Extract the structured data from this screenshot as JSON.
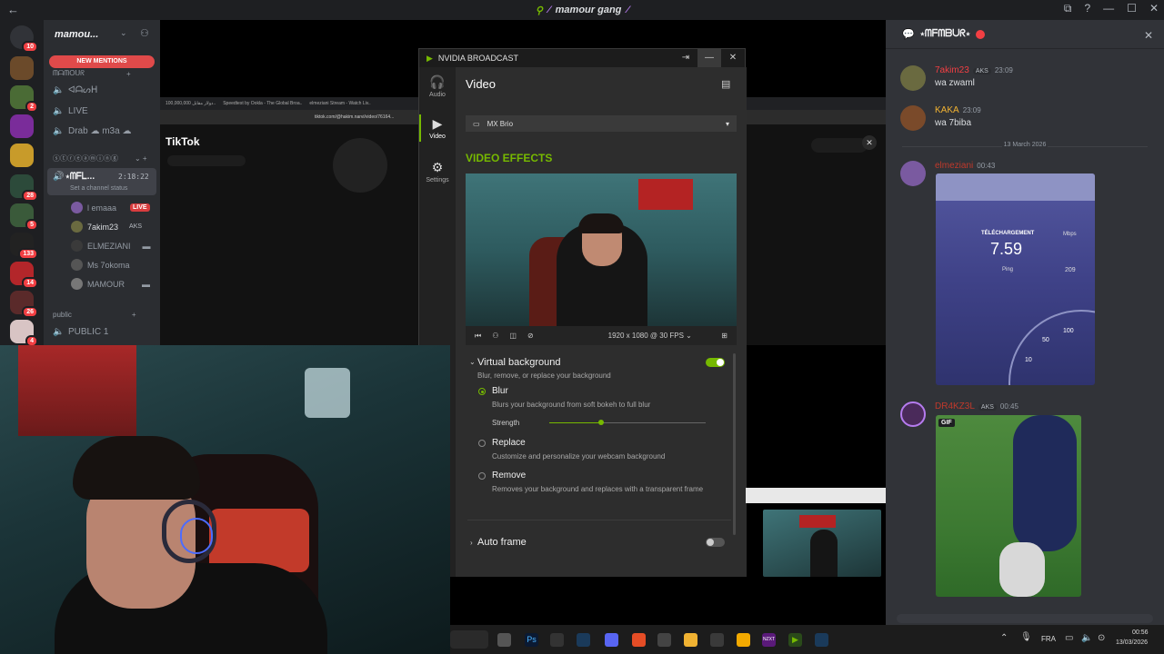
{
  "window": {
    "title": "mamour gang"
  },
  "sidebar": {
    "server_name": "mamou...",
    "new_mentions": "NEW MENTIONS",
    "category_one": "ᗰᗩᗰOᑌᖇ",
    "channels": [
      {
        "label": "ᐊᗩᔕᕼ",
        "icon": "speaker-icon"
      },
      {
        "label": "LIVE",
        "icon": "speaker-icon"
      },
      {
        "label": "Drab ☁ m3a ☁",
        "icon": "speaker-icon"
      }
    ],
    "category_two": "ⓢⓣⓡⓔⓐⓜⓘⓝⓖ",
    "active_channel": {
      "label": "⋆ᗰᖴᒪ...",
      "timer": "2:18:22",
      "status": "Set a channel status"
    },
    "voice_users": [
      {
        "name": "l emaaa",
        "live": "LIVE"
      },
      {
        "name": "7akim23",
        "tag": "AKS"
      },
      {
        "name": "ELMEZIANI"
      },
      {
        "name": "Ms 7okoma"
      },
      {
        "name": "MAMOUR"
      }
    ],
    "category_three": "public",
    "public_channel": "PUBLIC 1",
    "server_badges": [
      "10",
      "",
      "2",
      "",
      "",
      "28",
      "5",
      "133",
      "14",
      "26",
      "4"
    ]
  },
  "browser": {
    "tabs": [
      "100,000,000 دولار مقابل..",
      "Speedtest by Ookla - The Global Broa..",
      "elmeziani Stream - Watch Liv.."
    ],
    "url": "tiktok.com/@hakim.narvi/video/76164...",
    "logo": "TikTok"
  },
  "nvidia": {
    "title": "NVIDIA BROADCAST",
    "nav": [
      {
        "label": "Audio",
        "icon": "headphones-icon"
      },
      {
        "label": "Video",
        "icon": "camera-icon"
      },
      {
        "label": "Settings",
        "icon": "gear-icon"
      }
    ],
    "page_title": "Video",
    "device": "MX Brio",
    "section": "VIDEO EFFECTS",
    "resolution": "1920 x 1080 @ 30 FPS",
    "virtual_bg": {
      "title": "Virtual background",
      "desc": "Blur, remove, or replace your background",
      "enabled": true
    },
    "options": [
      {
        "label": "Blur",
        "desc": "Blurs your background from soft bokeh to full blur",
        "selected": true
      },
      {
        "label": "Replace",
        "desc": "Customize and personalize your webcam background",
        "selected": false
      },
      {
        "label": "Remove",
        "desc": "Removes your background and replaces with a transparent frame",
        "selected": false
      }
    ],
    "strength_label": "Strength",
    "strength": 0.33,
    "auto_frame": {
      "title": "Auto frame",
      "enabled": false
    },
    "colors": {
      "accent": "#76b900"
    }
  },
  "chat": {
    "header": "⋆ᗰᖴᗰᗷᑌᖇ⋆",
    "messages": [
      {
        "name": "7akim23",
        "tag": "AKS",
        "time": "23:09",
        "text": "wa zwaml",
        "color": "#f23f43"
      },
      {
        "name": "KAKA",
        "time": "23:09",
        "text": "wa 7biba",
        "color": "#f0b232"
      }
    ],
    "date_divider": "13 March 2026",
    "later": [
      {
        "name": "elmeziani",
        "time": "00:43",
        "color": "#c0392b"
      },
      {
        "name": "DR4KZ3L",
        "tag": "AKS",
        "time": "00:45",
        "color": "#c0392b"
      }
    ],
    "speedtest": {
      "label": "TÉLÉCHARGEMENT",
      "unit": "Mbps",
      "value": "7.59",
      "ping_label": "Ping",
      "ping": "209",
      "ticks": [
        "100",
        "50",
        "10"
      ]
    },
    "gif_badge": "GIF"
  },
  "taskbar": {
    "lang": "FRA",
    "time": "00:56",
    "date": "13/03/2026"
  }
}
